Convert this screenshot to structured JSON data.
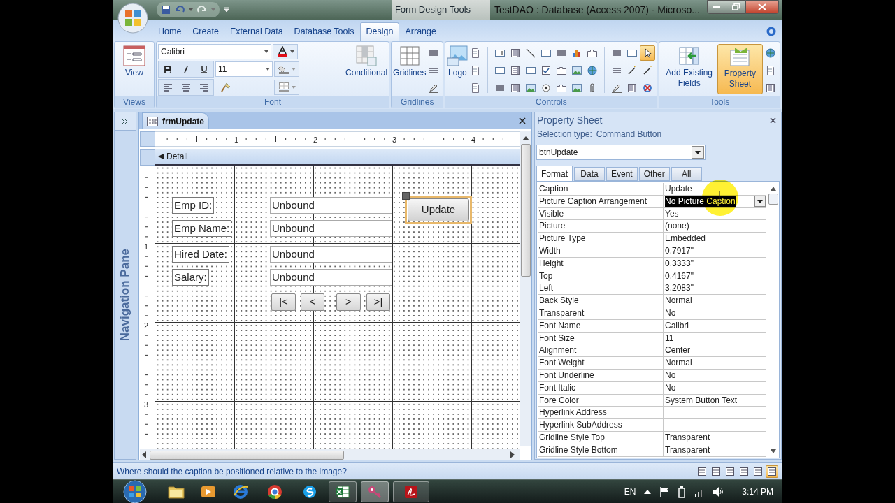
{
  "window": {
    "title": "TestDAO : Database (Access 2007) - Microso...",
    "context_label": "Form Design Tools"
  },
  "ribbon": {
    "tabs": [
      {
        "label": "Home",
        "selected": false
      },
      {
        "label": "Create",
        "selected": false
      },
      {
        "label": "External Data",
        "selected": false
      },
      {
        "label": "Database Tools",
        "selected": false
      },
      {
        "label": "Design",
        "selected": true
      },
      {
        "label": "Arrange",
        "selected": false
      }
    ],
    "groups": [
      "Views",
      "Font",
      "Gridlines",
      "Controls",
      "Tools"
    ],
    "view_button": "View",
    "font_name": "Calibri",
    "font_size": "11",
    "conditional_button": "Conditional",
    "gridlines_button": "Gridlines",
    "logo_button": "Logo",
    "select_tool": {
      "selected": true
    },
    "add_fields_button": "Add Existing Fields",
    "property_sheet_button": {
      "label": "Property Sheet",
      "selected": true
    }
  },
  "navigation_pane": {
    "label": "Navigation Pane"
  },
  "document": {
    "tab": "frmUpdate",
    "ruler_marks": [
      "1",
      "2",
      "3",
      "4"
    ],
    "vertical_ruler_marks": [
      "1",
      "2",
      "3"
    ],
    "section": "Detail",
    "fields": [
      {
        "label": "Emp ID:",
        "value": "Unbound"
      },
      {
        "label": "Emp Name:",
        "value": "Unbound"
      },
      {
        "label": "Hired Date:",
        "value": "Unbound"
      },
      {
        "label": "Salary:",
        "value": "Unbound"
      }
    ],
    "nav_buttons": [
      "|<",
      "<",
      ">",
      ">|"
    ],
    "command_button": {
      "caption": "Update",
      "selected": true
    }
  },
  "property_sheet": {
    "title": "Property Sheet",
    "selection_type_label": "Selection type:",
    "selection_type": "Command Button",
    "object": "btnUpdate",
    "tabs": [
      {
        "label": "Format",
        "selected": true
      },
      {
        "label": "Data",
        "selected": false
      },
      {
        "label": "Event",
        "selected": false
      },
      {
        "label": "Other",
        "selected": false
      },
      {
        "label": "All",
        "selected": false
      }
    ],
    "rows": [
      {
        "name": "Caption",
        "value": "Update",
        "selected": false
      },
      {
        "name": "Picture Caption Arrangement",
        "value": "No Picture Caption",
        "selected": true
      },
      {
        "name": "Visible",
        "value": "Yes",
        "selected": false
      },
      {
        "name": "Picture",
        "value": "(none)",
        "selected": false
      },
      {
        "name": "Picture Type",
        "value": "Embedded",
        "selected": false
      },
      {
        "name": "Width",
        "value": "0.7917\"",
        "selected": false
      },
      {
        "name": "Height",
        "value": "0.3333\"",
        "selected": false
      },
      {
        "name": "Top",
        "value": "0.4167\"",
        "selected": false
      },
      {
        "name": "Left",
        "value": "3.2083\"",
        "selected": false
      },
      {
        "name": "Back Style",
        "value": "Normal",
        "selected": false
      },
      {
        "name": "Transparent",
        "value": "No",
        "selected": false
      },
      {
        "name": "Font Name",
        "value": "Calibri",
        "selected": false
      },
      {
        "name": "Font Size",
        "value": "11",
        "selected": false
      },
      {
        "name": "Alignment",
        "value": "Center",
        "selected": false
      },
      {
        "name": "Font Weight",
        "value": "Normal",
        "selected": false
      },
      {
        "name": "Font Underline",
        "value": "No",
        "selected": false
      },
      {
        "name": "Font Italic",
        "value": "No",
        "selected": false
      },
      {
        "name": "Fore Color",
        "value": "System Button Text",
        "selected": false
      },
      {
        "name": "Hyperlink Address",
        "selected": false
      },
      {
        "name": "Hyperlink SubAddress",
        "selected": false
      },
      {
        "name": "Gridline Style Top",
        "value": "Transparent",
        "selected": false
      },
      {
        "name": "Gridline Style Bottom",
        "value": "Transparent",
        "selected": false
      }
    ]
  },
  "status_bar": {
    "text": "Where should the caption be positioned relative to the image?",
    "views": [
      {
        "selected": false
      },
      {
        "selected": false
      },
      {
        "selected": false
      },
      {
        "selected": false
      },
      {
        "selected": false
      },
      {
        "selected": true
      }
    ]
  },
  "taskbar": {
    "apps": [
      {
        "running": false,
        "selected": false
      },
      {
        "running": false,
        "selected": false
      },
      {
        "running": false,
        "selected": false
      },
      {
        "running": false,
        "selected": false
      },
      {
        "running": false,
        "selected": false
      },
      {
        "running": true,
        "selected": false
      },
      {
        "running": true,
        "selected": true
      },
      {
        "running": true,
        "selected": false
      }
    ],
    "language": "EN",
    "time": "3:14 PM"
  }
}
